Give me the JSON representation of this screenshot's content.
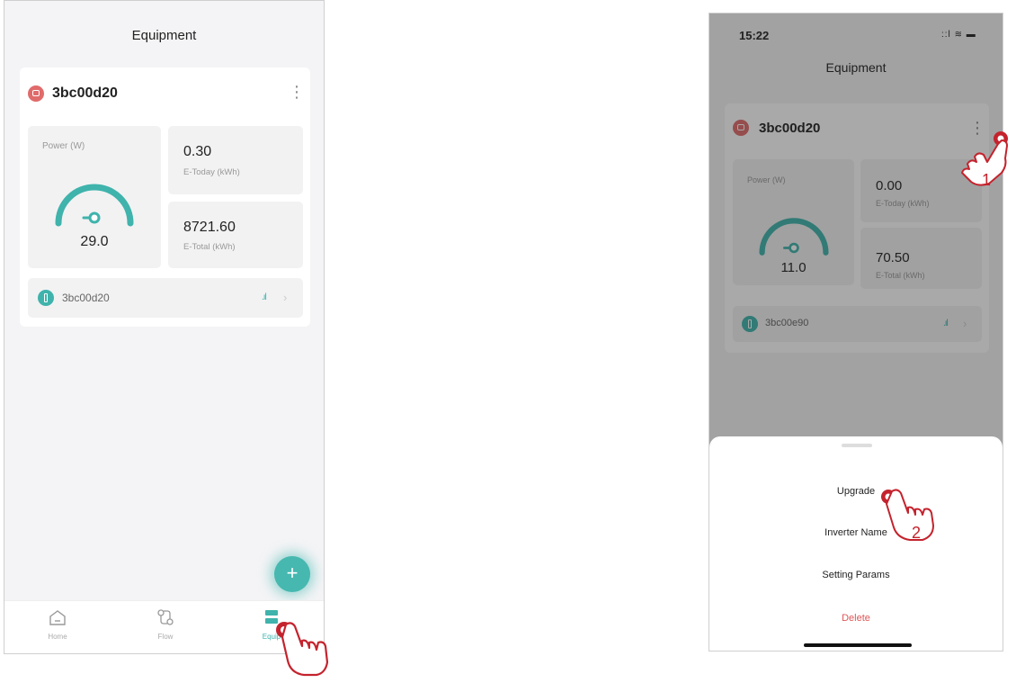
{
  "left_screen": {
    "title": "Equipment",
    "device": {
      "name": "3bc00d20",
      "power_label": "Power (W)",
      "power_value": "29.0",
      "power_fraction": 0.8,
      "e_today_value": "0.30",
      "e_today_label": "E-Today (kWh)",
      "e_total_value": "8721.60",
      "e_total_label": "E-Total (kWh)",
      "sub_device": "3bc00d20"
    },
    "fab_label": "+",
    "tabs": [
      {
        "label": "Home",
        "icon": "home-icon"
      },
      {
        "label": "Flow",
        "icon": "flow-icon"
      },
      {
        "label": "Equip",
        "icon": "equipment-icon"
      }
    ]
  },
  "right_screen": {
    "status_time": "15:22",
    "title": "Equipment",
    "device": {
      "name": "3bc00d20",
      "power_label": "Power (W)",
      "power_value": "11.0",
      "power_fraction": 0.8,
      "e_today_value": "0.00",
      "e_today_label": "E-Today (kWh)",
      "e_total_value": "70.50",
      "e_total_label": "E-Total (kWh)",
      "sub_device": "3bc00e90"
    },
    "sheet_items": [
      "Upgrade",
      "Inverter Name",
      "Setting Params",
      "Delete"
    ],
    "steps": [
      "1",
      "2"
    ]
  },
  "colors": {
    "accent": "#3fb3ac",
    "device_icon": "#e06b6b",
    "delete": "#e05555",
    "hand_stroke": "#c4232d"
  }
}
